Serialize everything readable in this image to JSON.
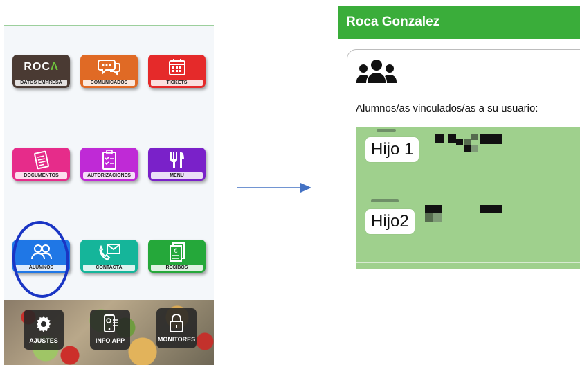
{
  "left_app": {
    "tiles": [
      {
        "label": "DATOS EMPRESA",
        "logo_text": "ROCA",
        "color": "#4a3a33",
        "icon": "roca-logo"
      },
      {
        "label": "COMUNICADOS",
        "color": "#e06a25",
        "icon": "chat-bubbles-icon"
      },
      {
        "label": "TICKETS",
        "color": "#e52a2a",
        "icon": "calendar-icon"
      },
      {
        "label": "DOCUMENTOS",
        "color": "#e62c8a",
        "icon": "document-icon"
      },
      {
        "label": "AUTORIZACIONES",
        "color": "#bf2ad6",
        "icon": "checklist-icon"
      },
      {
        "label": "MENU",
        "color": "#7a21c9",
        "icon": "fork-knife-icon"
      },
      {
        "label": "ALUMNOS",
        "color": "#1f77e6",
        "icon": "users-icon"
      },
      {
        "label": "CONTACTA",
        "color": "#15b59a",
        "icon": "envelope-phone-icon"
      },
      {
        "label": "RECIBOS",
        "color": "#25a83a",
        "icon": "receipts-icon"
      }
    ],
    "bottom_buttons": [
      {
        "label": "AJUSTES",
        "icon": "gear-icon"
      },
      {
        "label": "INFO APP",
        "icon": "phone-info-icon"
      },
      {
        "label": "MONITORES",
        "icon": "lock-icon"
      }
    ]
  },
  "right_app": {
    "header_title": "Roca Gonzalez",
    "header_color": "#3aad3a",
    "card_subtitle": "Alumnos/as vinculados/as a su usuario:",
    "students": [
      {
        "name": "Hijo 1"
      },
      {
        "name": "Hijo2"
      }
    ],
    "list_color": "#9fd08d"
  },
  "annotation": {
    "color": "#1a35c4"
  },
  "arrow": {
    "color": "#4472c4"
  }
}
